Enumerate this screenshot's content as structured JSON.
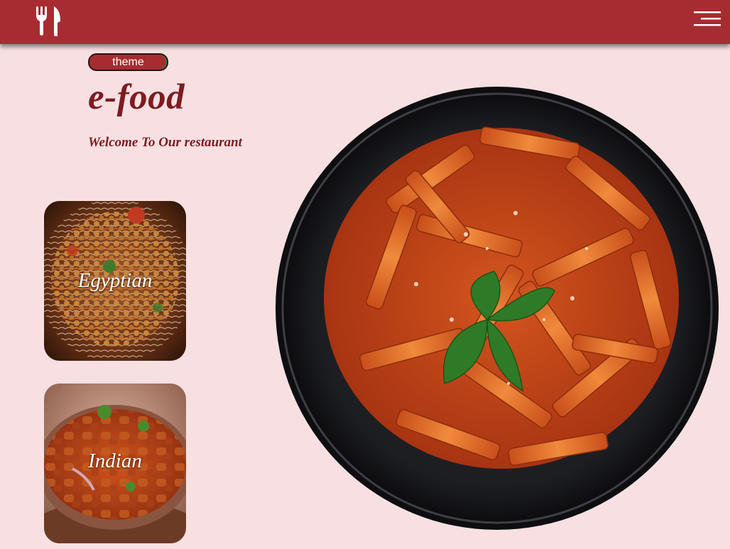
{
  "header": {
    "logo_icon": "fork-knife-icon",
    "menu_icon": "hamburger-menu-icon",
    "background_color": "#a72c31"
  },
  "hero": {
    "theme_button_label": "theme",
    "brand_title": "e-food",
    "welcome_text": "Welcome To Our restaurant",
    "image": "penne-pasta-bowl"
  },
  "categories": [
    {
      "label": "Egyptian",
      "image": "koshari-dish"
    },
    {
      "label": "Indian",
      "image": "curry-chicken-dish"
    }
  ],
  "colors": {
    "page_background": "#f8e0e2",
    "accent": "#a72c31",
    "title_text": "#7c1c21"
  }
}
